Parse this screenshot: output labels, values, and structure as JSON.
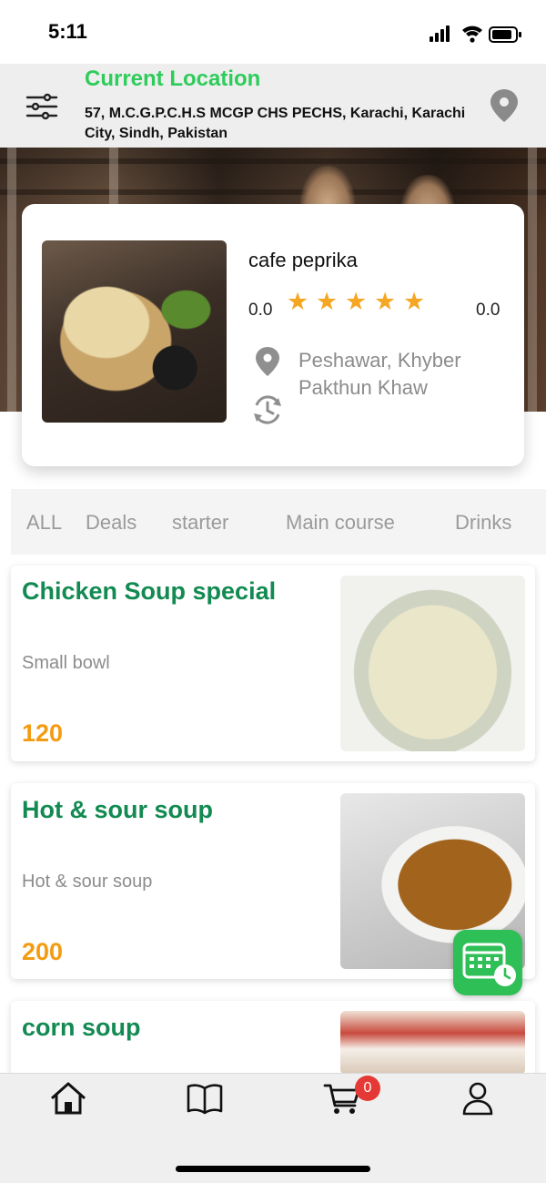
{
  "status_bar": {
    "time": "5:11"
  },
  "header": {
    "title": "Current Location",
    "address": "57, M.C.G.P.C.H.S MCGP CHS PECHS, Karachi, Karachi City, Sindh, Pakistan",
    "icons": {
      "menu": "sliders-icon",
      "location": "map-pin-icon"
    }
  },
  "restaurant": {
    "name": "cafe peprika",
    "rating_left": "0.0",
    "rating_right": "0.0",
    "stars": 5,
    "location": "Peshawar, Khyber Pakthun Khaw"
  },
  "tabs": [
    "ALL",
    "Deals",
    "starter",
    "Main course",
    "Drinks"
  ],
  "menu_items": [
    {
      "title": "Chicken Soup special",
      "description": "Small bowl",
      "price": "120"
    },
    {
      "title": "Hot & sour soup",
      "description": "Hot & sour soup",
      "price": "200"
    },
    {
      "title": "corn soup"
    }
  ],
  "cart": {
    "badge": "0"
  },
  "colors": {
    "accent": "#2ecc5b",
    "item_title": "#128a52",
    "price": "#f39c12",
    "star": "#f5a623",
    "badge": "#e53935"
  }
}
